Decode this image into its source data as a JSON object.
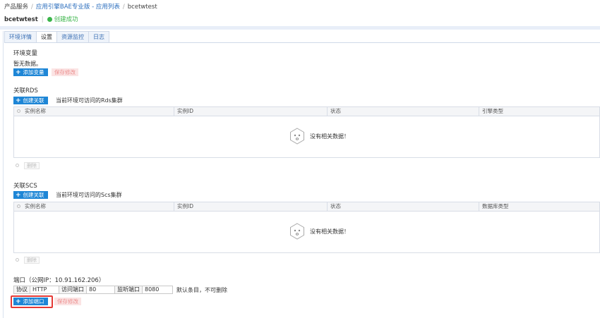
{
  "breadcrumb": {
    "root": "产品服务",
    "level1": "应用引擎BAE专业版 - 应用列表",
    "current": "bcetwtest"
  },
  "app": {
    "name": "bcetwtest",
    "status": "创建成功",
    "status_color": "#3bb54a"
  },
  "tabs": [
    {
      "label": "环境详情",
      "active": false
    },
    {
      "label": "设置",
      "active": true
    },
    {
      "label": "资源监控",
      "active": false
    },
    {
      "label": "日志",
      "active": false
    }
  ],
  "env": {
    "title": "环境变量",
    "empty_text": "暂无数据。",
    "add_button": "添加变量",
    "save_button": "保存修改"
  },
  "rds": {
    "title": "关联RDS",
    "create_button": "创建关联",
    "hint": "当前环境可访问的Rds集群",
    "columns": [
      "实例名称",
      "实例ID",
      "状态",
      "引擎类型"
    ],
    "empty_text": "没有相关数据！",
    "delete_button": "删除"
  },
  "scs": {
    "title": "关联SCS",
    "create_button": "创建关联",
    "hint": "当前环境可访问的Scs集群",
    "columns": [
      "实例名称",
      "实例ID",
      "状态",
      "数据库类型"
    ],
    "empty_text": "没有相关数据！",
    "delete_button": "删除"
  },
  "ports": {
    "title": "端口（公网IP：10.91.162.206）",
    "row": {
      "protocol_label": "协议",
      "protocol_value": "HTTP",
      "access_label": "访问端口",
      "access_value": "80",
      "listen_label": "监听端口",
      "listen_value": "8080",
      "note": "默认条目，不可删除"
    },
    "add_button": "添加端口",
    "save_button": "保存修改"
  },
  "colors": {
    "accent": "#1e86d6",
    "highlight": "#e53935"
  }
}
